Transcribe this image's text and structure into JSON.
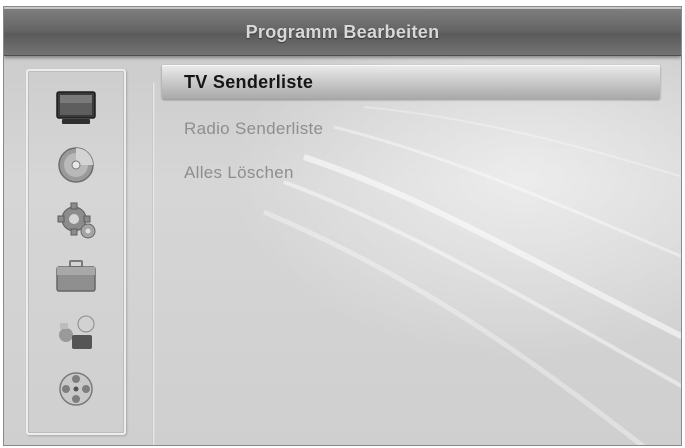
{
  "header": {
    "title": "Programm Bearbeiten"
  },
  "sidebar": {
    "items": [
      {
        "icon": "tv-icon",
        "selected": true
      },
      {
        "icon": "disc-icon"
      },
      {
        "icon": "gear-icon"
      },
      {
        "icon": "toolbox-icon"
      },
      {
        "icon": "apps-icon"
      },
      {
        "icon": "film-reel-icon"
      }
    ]
  },
  "menu": {
    "items": [
      {
        "label": "TV Senderliste",
        "selected": true
      },
      {
        "label": "Radio Senderliste"
      },
      {
        "label": "Alles Löschen"
      }
    ]
  }
}
